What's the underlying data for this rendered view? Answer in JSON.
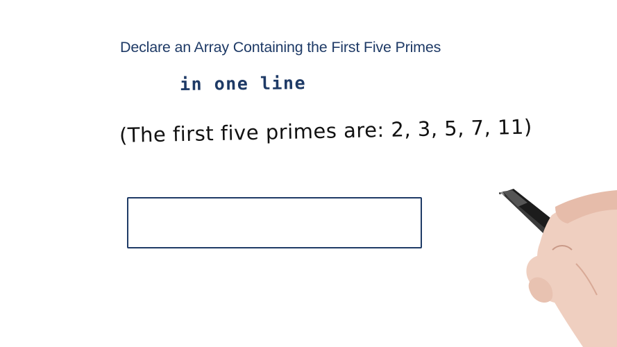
{
  "lesson": {
    "title": "Declare an Array Containing the First Five Primes",
    "subtitle": "in one line",
    "note": "(The first five primes are: 2, 3, 5, 7, 11)"
  },
  "answer_input": {
    "value": ""
  },
  "colors": {
    "title": "#1e3a66",
    "handwriting": "#111111",
    "box_border": "#1e3a66",
    "background": "#ffffff"
  }
}
